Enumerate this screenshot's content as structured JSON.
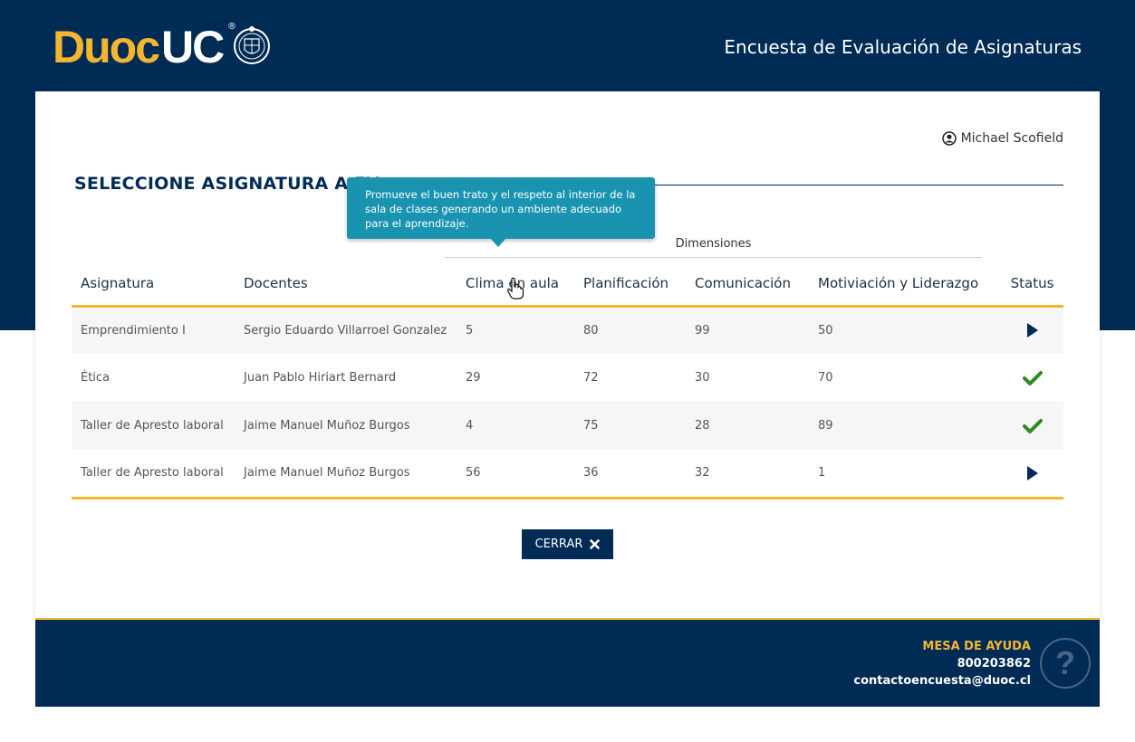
{
  "header": {
    "logo_primary": "Duoc",
    "logo_secondary": "UC",
    "logo_registered": "®",
    "title": "Encuesta de Evaluación de Asignaturas"
  },
  "user": {
    "name": "Michael Scofield",
    "icon": "user-circle-icon"
  },
  "section": {
    "title": "SELECCIONE ASIGNATURA A EV"
  },
  "table": {
    "group_header": "Dimensiones",
    "columns": [
      "Asignatura",
      "Docentes",
      "Clima en aula",
      "Planificación",
      "Comunicación",
      "Motiviación y Liderazgo",
      "Status"
    ],
    "rows": [
      {
        "asignatura": "Emprendimiento I",
        "docente": "Sergio Eduardo Villarroel Gonzalez",
        "clima": "5",
        "planificacion": "80",
        "comunicacion": "99",
        "motivacion": "50",
        "status": "pending"
      },
      {
        "asignatura": "Ética",
        "docente": "Juan Pablo Hiriart Bernard",
        "clima": "29",
        "planificacion": "72",
        "comunicacion": "30",
        "motivacion": "70",
        "status": "done"
      },
      {
        "asignatura": "Taller de Apresto laboral",
        "docente": "Jaime Manuel Muñoz Burgos",
        "clima": "4",
        "planificacion": "75",
        "comunicacion": "28",
        "motivacion": "89",
        "status": "done"
      },
      {
        "asignatura": "Taller de Apresto laboral",
        "docente": "Jaime Manuel Muñoz Burgos",
        "clima": "56",
        "planificacion": "36",
        "comunicacion": "32",
        "motivacion": "1",
        "status": "pending"
      }
    ]
  },
  "tooltip": {
    "text": "Promueve el buen trato y el respeto al interior de la sala de clases generando un ambiente adecuado para el aprendizaje."
  },
  "buttons": {
    "close_label": "CERRAR"
  },
  "footer": {
    "help_title": "MESA DE AYUDA",
    "phone": "800203862",
    "email": "contactoencuesta@duoc.cl",
    "help_icon_glyph": "?"
  },
  "colors": {
    "navy": "#002b55",
    "gold": "#f4b630",
    "tooltip": "#1a93b0",
    "check": "#2e8b1e"
  }
}
